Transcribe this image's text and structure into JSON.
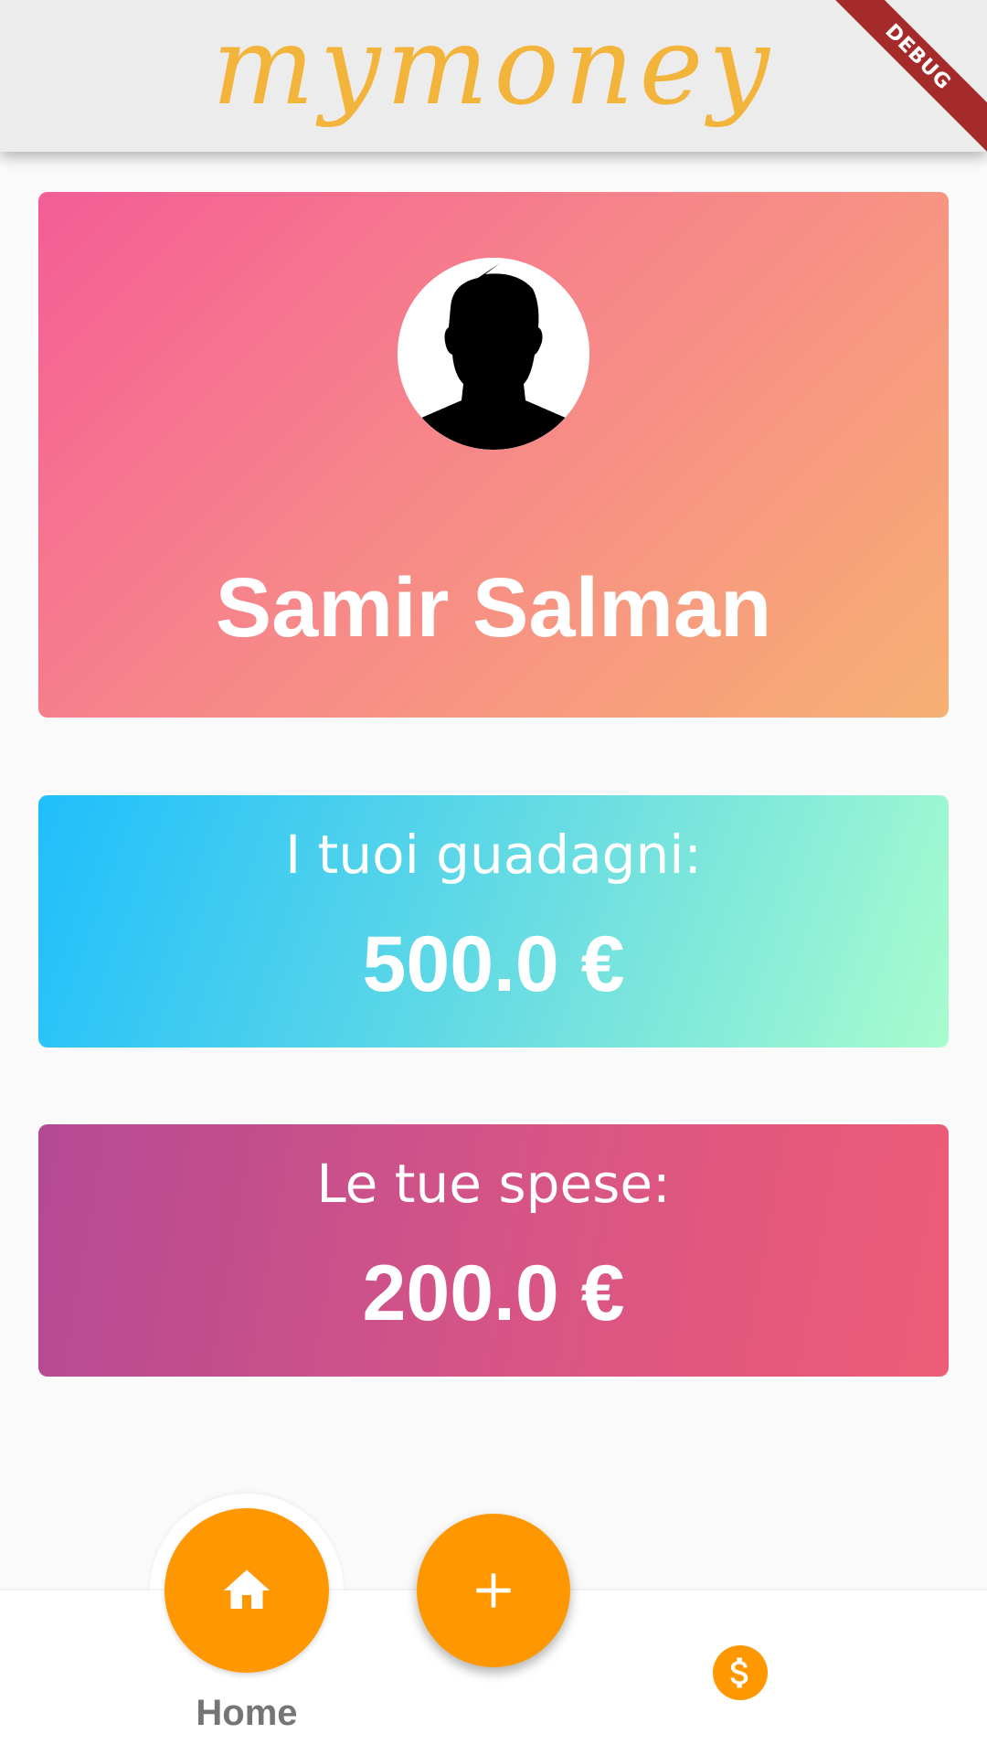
{
  "app_bar": {
    "title": "mymoney",
    "title_color": "#f3b43b",
    "background": "#ececec"
  },
  "debug_banner": {
    "label": "DEBUG",
    "color": "#a52a2a"
  },
  "profile": {
    "avatar_icon": "default-person-silhouette",
    "name": "Samir Salman",
    "gradient": [
      "#f45d96",
      "#f7b073"
    ]
  },
  "earnings": {
    "label": "I tuoi guadagni:",
    "value": "500.0 €",
    "gradient": [
      "#1fbefc",
      "#a8fcce"
    ]
  },
  "expenses": {
    "label": "Le tue spese:",
    "value": "200.0 €",
    "gradient": [
      "#b44a94",
      "#ee5c76"
    ]
  },
  "bottom_nav": {
    "accent": "#ff9800",
    "items": [
      {
        "icon": "home-icon",
        "label": "Home",
        "selected": true
      },
      {
        "icon": "plus-icon",
        "label": "",
        "selected": false
      },
      {
        "icon": "dollar-icon",
        "label": "",
        "selected": false
      }
    ]
  }
}
